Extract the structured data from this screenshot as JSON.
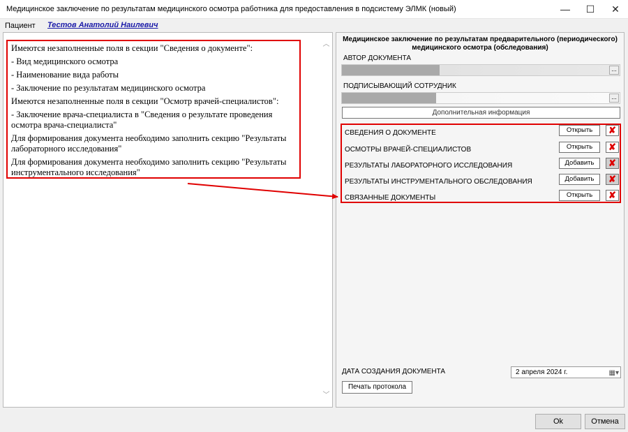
{
  "window": {
    "title": "Медицинское заключение по результатам медицинского осмотра работника для предоставления в подсистему ЭЛМК (новый)",
    "minimize": "—",
    "maximize": "☐",
    "close": "✕"
  },
  "patient": {
    "label": "Пациент",
    "name": "Тестов Анатолий Наилевич"
  },
  "messages": [
    "Имеются незаполненные поля в секции \"Сведения о документе\":",
    "- Вид медицинского осмотра",
    "- Наименование вида работы",
    "- Заключение по результатам медицинского осмотра",
    "Имеются незаполненные поля в секции \"Осмотр врачей-специалистов\":",
    "- Заключение врача-специалиста в \"Сведения о результате проведения осмотра врача-специалиста\"",
    "Для формирования документа необходимо заполнить секцию \"Результаты лабораторного исследования\"",
    "Для формирования документа необходимо заполнить секцию \"Результаты инструментального исследования\""
  ],
  "document": {
    "title_line1": "Медицинское заключение по результатам предварительного (периодического)",
    "title_line2": "медицинского осмотра (обследования)",
    "author_label": "АВТОР ДОКУМЕНТА",
    "signer_label": "ПОДПИСЫВАЮЩИЙ СОТРУДНИК",
    "dots": "...",
    "additional_info": "Дополнительная информация",
    "sections": [
      {
        "label": "СВЕДЕНИЯ О ДОКУМЕНТЕ",
        "action": "Открыть"
      },
      {
        "label": "ОСМОТРЫ ВРАЧЕЙ-СПЕЦИАЛИСТОВ",
        "action": "Открыть"
      },
      {
        "label": "РЕЗУЛЬТАТЫ ЛАБОРАТОРНОГО ИССЛЕДОВАНИЯ",
        "action": "Добавить"
      },
      {
        "label": "РЕЗУЛЬТАТЫ ИНСТРУМЕНТАЛЬНОГО ОБСЛЕДОВАНИЯ",
        "action": "Добавить"
      },
      {
        "label": "СВЯЗАННЫЕ ДОКУМЕНТЫ",
        "action": "Открыть"
      }
    ],
    "delete_glyph": "✘",
    "date_label": "ДАТА СОЗДАНИЯ ДОКУМЕНТА",
    "date_value": "2  апреля  2024 г.",
    "print_button": "Печать протокола"
  },
  "footer": {
    "ok": "Ok",
    "cancel": "Отмена"
  },
  "colors": {
    "highlight": "#e00000",
    "link": "#1a1aa8"
  }
}
